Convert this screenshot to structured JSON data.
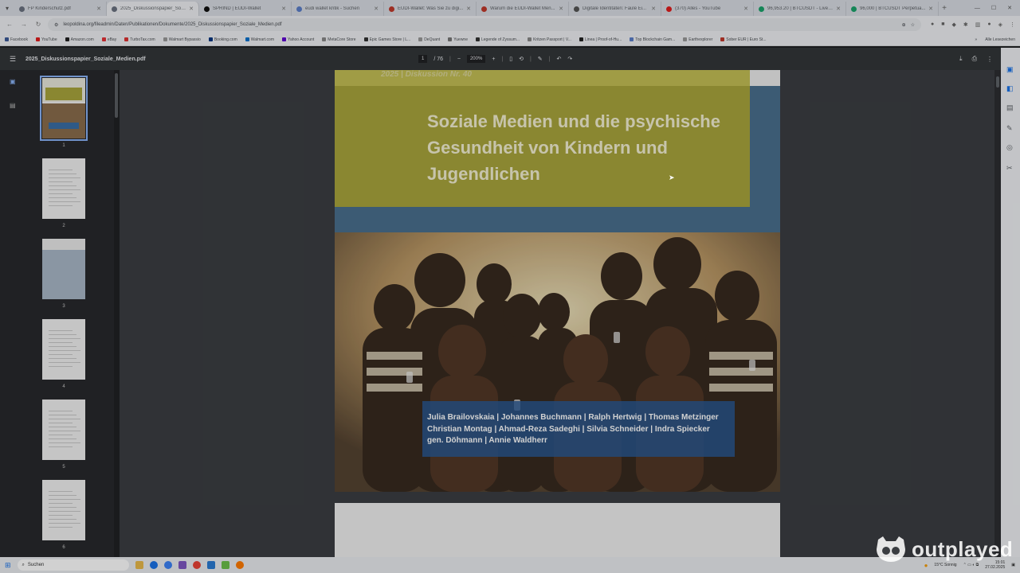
{
  "tabs": [
    {
      "title": "FP Kinderschutz.pdf",
      "color": "#6b7280"
    },
    {
      "title": "2025_Diskussionspapier_Sozi...",
      "color": "#6b7280",
      "active": true
    },
    {
      "title": "SPRIND | EUDI-Wallet",
      "color": "#111111"
    },
    {
      "title": "eudi wallet kritik - Suchen",
      "color": "#5b7ec9"
    },
    {
      "title": "EUDI-Wallet: Was Sie zu digi...",
      "color": "#c0392b"
    },
    {
      "title": "Warum die EUDI-Wallet Men...",
      "color": "#c0392b"
    },
    {
      "title": "Digitale Identitäten: Faule Ei...",
      "color": "#555555"
    },
    {
      "title": "(370) Alles - YouTube",
      "color": "#e11d1d"
    },
    {
      "title": "96,953.20 | BTCUSDT - Live-S...",
      "color": "#1aa36b"
    },
    {
      "title": "96,000 | BTCUSDT Perpetua...",
      "color": "#1aa36b"
    }
  ],
  "address": {
    "url": "leopoldina.org/fileadmin/Daten/Publikationen/Dokumente/2025_Diskussionspapier_Soziale_Medien.pdf"
  },
  "bookmarks": [
    {
      "label": "Facebook",
      "color": "#3b5998"
    },
    {
      "label": "YouTube",
      "color": "#e11d1d"
    },
    {
      "label": "Amazon.com",
      "color": "#222222"
    },
    {
      "label": "eBay",
      "color": "#e53238"
    },
    {
      "label": "TurboTax.com",
      "color": "#d33"
    },
    {
      "label": "Walmart Bypassio",
      "color": "#999999"
    },
    {
      "label": "Booking.com",
      "color": "#003580"
    },
    {
      "label": "Walmart.com",
      "color": "#0071ce"
    },
    {
      "label": "Yahoo Account",
      "color": "#6001d2"
    },
    {
      "label": "MetaCore Store",
      "color": "#888888"
    },
    {
      "label": "Epic Games Store | L...",
      "color": "#333333"
    },
    {
      "label": "DeQuant",
      "color": "#999999"
    },
    {
      "label": "Yuewne",
      "color": "#777777"
    },
    {
      "label": "Legende of Zyssum...",
      "color": "#333333"
    },
    {
      "label": "Kritzen Passport | V...",
      "color": "#888888"
    },
    {
      "label": "Linea | Proof-of-Hu...",
      "color": "#222222"
    },
    {
      "label": "Top Blockchain Gam...",
      "color": "#5b7ec9"
    },
    {
      "label": "Earthexplorer",
      "color": "#999999"
    },
    {
      "label": "Sober EUR | Euro St...",
      "color": "#c0392b"
    }
  ],
  "bookmarks_all": "Alle Lesezeichen",
  "pdf": {
    "filename": "2025_Diskussionspapier_Soziale_Medien.pdf",
    "page_current": "1",
    "page_total": "/ 76",
    "zoom": "200%"
  },
  "thumbnails": [
    "1",
    "2",
    "3",
    "4",
    "5",
    "6"
  ],
  "cover": {
    "series": "2025 | Diskussion Nr. 40",
    "title": "Soziale Medien und die psychische Gesundheit von Kindern und Jugendlichen",
    "authors_line1": "Julia Brailovskaia | Johannes Buchmann | Ralph Hertwig | Thomas Metzinger",
    "authors_line2": "Christian Montag | Ahmad-Reza Sadeghi | Silvia Schneider | Indra Spiecker",
    "authors_line3": "gen. Döhmann | Annie Waldherr"
  },
  "taskbar": {
    "search_placeholder": "Suchen",
    "weather": "15°C  Sonnig",
    "time": "15:01",
    "date": "27.02.2025"
  },
  "watermark": {
    "text": "outplayed"
  }
}
